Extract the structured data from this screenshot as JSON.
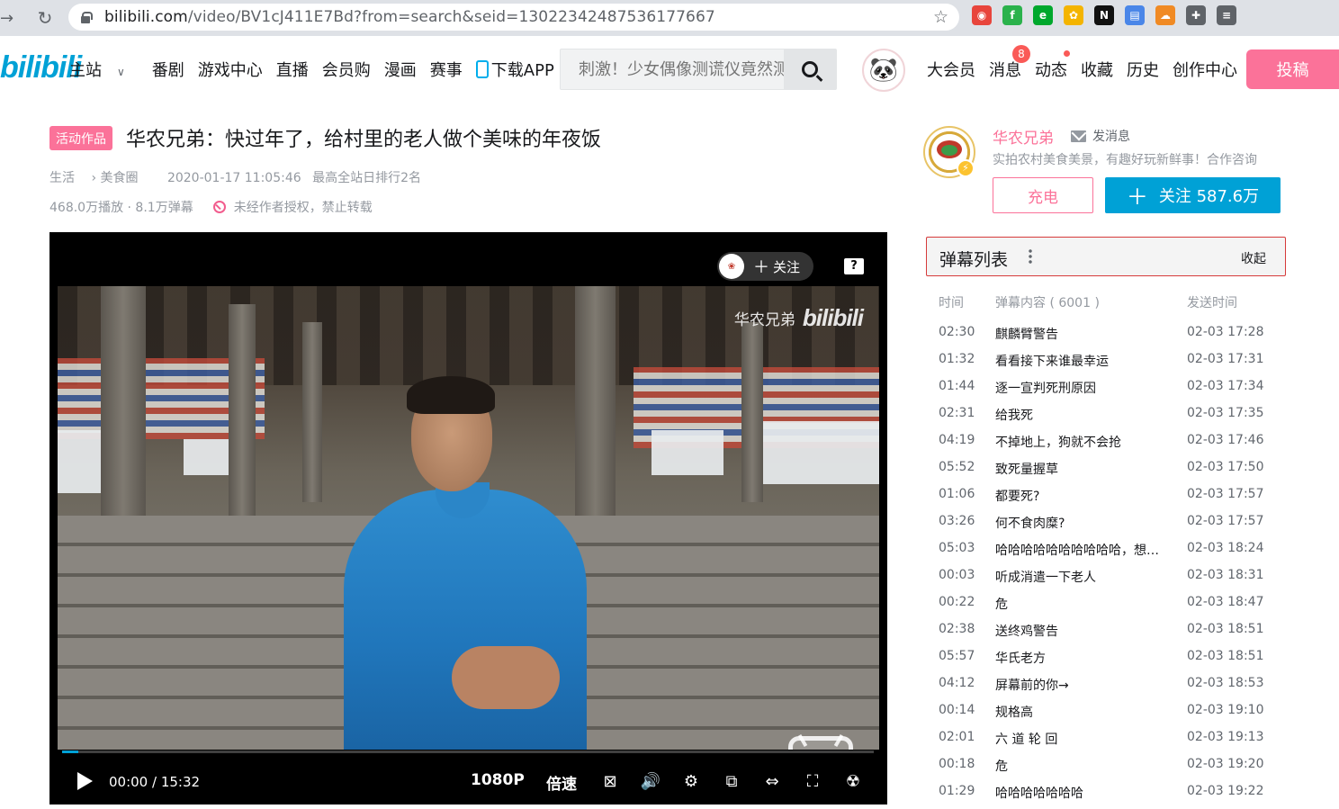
{
  "browser": {
    "url_host": "bilibili.com",
    "url_path": "/video/BV1cJ411E7Bd?from=search&seid=13022342487536177667",
    "extensions": [
      {
        "name": "chrome-icon",
        "color": "#e8453c",
        "glyph": "◉"
      },
      {
        "name": "feedly-icon",
        "color": "#2bb24c",
        "glyph": "f"
      },
      {
        "name": "evernote-icon",
        "color": "#00a82d",
        "glyph": "e"
      },
      {
        "name": "photos-icon",
        "color": "#f4b400",
        "glyph": "✿"
      },
      {
        "name": "notion-icon",
        "color": "#111111",
        "glyph": "N"
      },
      {
        "name": "docs-icon",
        "color": "#4a86e8",
        "glyph": "▤"
      },
      {
        "name": "cloud-icon",
        "color": "#f08a24",
        "glyph": "☁"
      },
      {
        "name": "puzzle-icon",
        "color": "#5f6368",
        "glyph": "✚"
      },
      {
        "name": "readinglist-icon",
        "color": "#5f6368",
        "glyph": "≡"
      }
    ]
  },
  "header": {
    "logo": "bilibili",
    "nav": [
      "主站",
      "番剧",
      "游戏中心",
      "直播",
      "会员购",
      "漫画",
      "赛事",
      "下载APP"
    ],
    "search_placeholder": "刺激！少女偶像测谎仪竟然测",
    "right_nav": [
      "大会员",
      "消息",
      "动态",
      "收藏",
      "历史",
      "创作中心"
    ],
    "message_count": "8",
    "upload_label": "投稿"
  },
  "video": {
    "tag": "活动作品",
    "title": "华农兄弟：快过年了，给村里的老人做个美味的年夜饭",
    "category": "生活",
    "subcategory": "美食圈",
    "date": "2020-01-17 11:05:46",
    "rank": "最高全站日排行2名",
    "views": "468.0万播放 · 8.1万弹幕",
    "copyright": "未经作者授权，禁止转载"
  },
  "player": {
    "watermark_name": "华农兄弟",
    "watermark_logo": "bilibili",
    "follow_chip": "关注",
    "help": "?",
    "time_current": "00:00",
    "time_total": "15:32",
    "quality": "1080P",
    "speed": "倍速",
    "progress": 0.02
  },
  "uploader": {
    "name": "华农兄弟",
    "message_label": "发消息",
    "description": "实拍农村美食美景，有趣好玩新鲜事！合作咨询",
    "charge_label": "充电",
    "follow_label": "关注 587.6万"
  },
  "danmaku": {
    "title": "弹幕列表",
    "collapse_label": "收起",
    "col_time": "时间",
    "col_content": "弹幕内容 ( 6001 )",
    "col_sent": "发送时间",
    "rows": [
      {
        "t": "02:30",
        "c": "麒麟臂警告",
        "s": "02-03 17:28"
      },
      {
        "t": "01:32",
        "c": "看看接下来谁最幸运",
        "s": "02-03 17:31"
      },
      {
        "t": "01:44",
        "c": "逐一宣判死刑原因",
        "s": "02-03 17:34"
      },
      {
        "t": "02:31",
        "c": "给我死",
        "s": "02-03 17:35"
      },
      {
        "t": "04:19",
        "c": "不掉地上，狗就不会抢",
        "s": "02-03 17:46"
      },
      {
        "t": "05:52",
        "c": "致死量握草",
        "s": "02-03 17:50"
      },
      {
        "t": "01:06",
        "c": "都要死?",
        "s": "02-03 17:57"
      },
      {
        "t": "03:26",
        "c": "何不食肉糜?",
        "s": "02-03 17:57"
      },
      {
        "t": "05:03",
        "c": "哈哈哈哈哈哈哈哈哈哈，想…",
        "s": "02-03 18:24"
      },
      {
        "t": "00:03",
        "c": "听成消遣一下老人",
        "s": "02-03 18:31"
      },
      {
        "t": "00:22",
        "c": "危",
        "s": "02-03 18:47"
      },
      {
        "t": "02:38",
        "c": "送终鸡警告",
        "s": "02-03 18:51"
      },
      {
        "t": "05:57",
        "c": "华氏老方",
        "s": "02-03 18:51"
      },
      {
        "t": "04:12",
        "c": "屏幕前的你→",
        "s": "02-03 18:53"
      },
      {
        "t": "00:14",
        "c": "规格高",
        "s": "02-03 19:10"
      },
      {
        "t": "02:01",
        "c": "六 道 轮 回",
        "s": "02-03 19:13"
      },
      {
        "t": "00:18",
        "c": "危",
        "s": "02-03 19:20"
      },
      {
        "t": "01:29",
        "c": "哈哈哈哈哈哈哈",
        "s": "02-03 19:22"
      }
    ]
  }
}
